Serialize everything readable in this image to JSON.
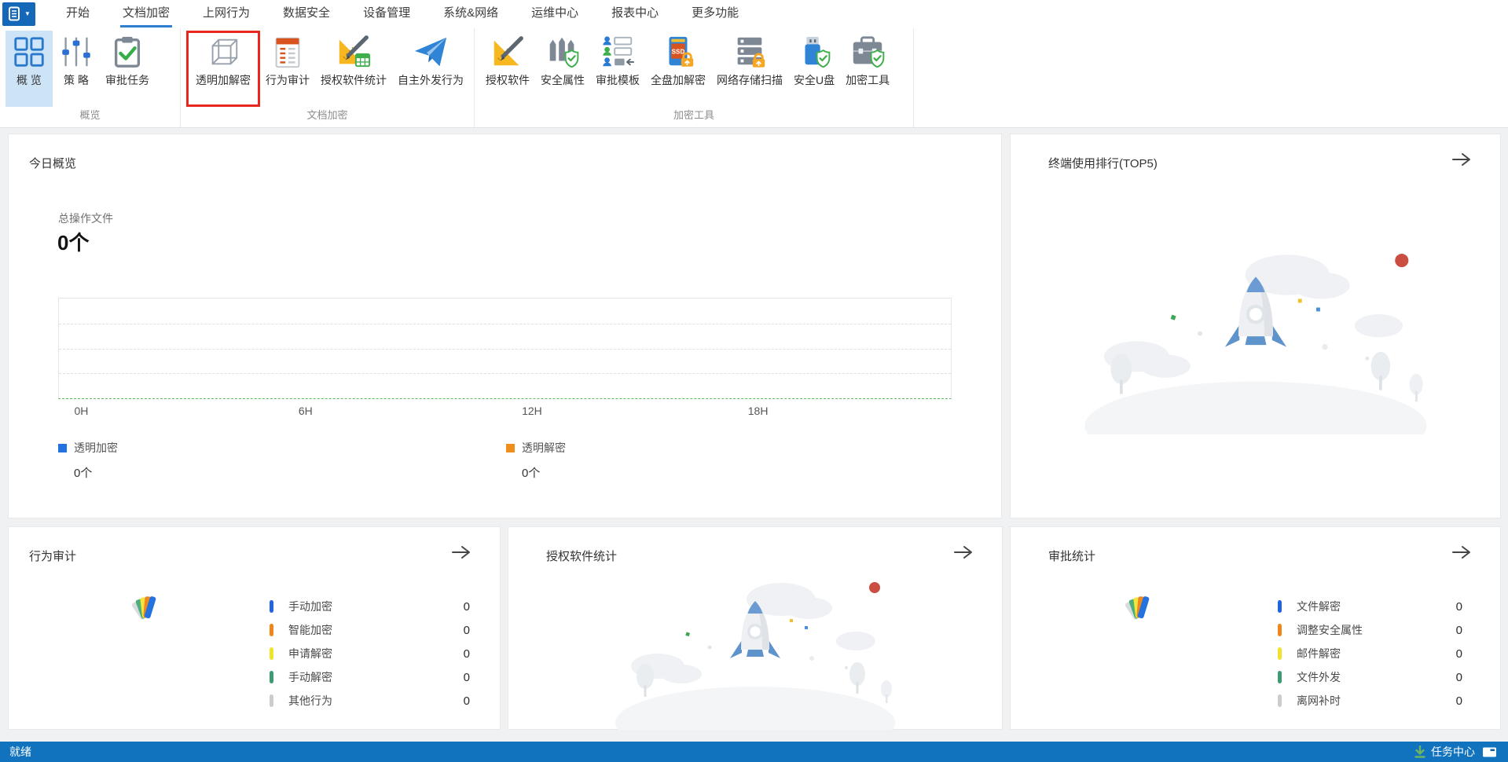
{
  "menubar": {
    "active_tab": "文档加密",
    "tabs": [
      {
        "label": "开始"
      },
      {
        "label": "文档加密"
      },
      {
        "label": "上网行为"
      },
      {
        "label": "数据安全"
      },
      {
        "label": "设备管理"
      },
      {
        "label": "系统&网络"
      },
      {
        "label": "运维中心"
      },
      {
        "label": "报表中心"
      },
      {
        "label": "更多功能"
      }
    ]
  },
  "ribbon": {
    "ssd_icon_text": "SSD",
    "highlight_color": "#e8281e",
    "selected_bg": "#cde4f7",
    "groups": [
      {
        "label": "概览",
        "items": [
          {
            "label": "概 览",
            "icon": "grid-overview-icon",
            "selected": true
          },
          {
            "label": "策 略",
            "icon": "sliders-policy-icon"
          },
          {
            "label": "审批任务",
            "icon": "clipboard-check-icon"
          }
        ]
      },
      {
        "label": "文档加密",
        "items": [
          {
            "label": "透明加解密",
            "icon": "wireframe-cube-icon",
            "highlighted": true
          },
          {
            "label": "行为审计",
            "icon": "audit-document-icon"
          },
          {
            "label": "授权软件统计",
            "icon": "ruler-pencil-table-icon"
          },
          {
            "label": "自主外发行为",
            "icon": "paper-plane-icon"
          }
        ]
      },
      {
        "label": "加密工具",
        "items": [
          {
            "label": "授权软件",
            "icon": "ruler-pencil-icon"
          },
          {
            "label": "安全属性",
            "icon": "fence-shield-icon"
          },
          {
            "label": "审批模板",
            "icon": "people-template-icon"
          },
          {
            "label": "全盘加解密",
            "icon": "ssd-lock-icon"
          },
          {
            "label": "网络存储扫描",
            "icon": "server-lock-icon"
          },
          {
            "label": "安全U盘",
            "icon": "usb-shield-icon"
          },
          {
            "label": "加密工具",
            "icon": "briefcase-shield-icon"
          }
        ]
      }
    ]
  },
  "cards": {
    "today": {
      "title": "今日概览",
      "total_label": "总操作文件",
      "total_value": "0个",
      "x_ticks": [
        "0H",
        "6H",
        "12H",
        "18H"
      ],
      "legend": [
        {
          "label": "透明加密",
          "value": "0个",
          "color": "#2272e0"
        },
        {
          "label": "透明解密",
          "value": "0个",
          "color": "#ef8d1d"
        }
      ]
    },
    "top5": {
      "title": "终端使用排行(TOP5)"
    },
    "behavior": {
      "title": "行为审计",
      "rows": [
        {
          "label": "手动加密",
          "value": "0",
          "color": "#2064e0"
        },
        {
          "label": "智能加密",
          "value": "0",
          "color": "#f08519"
        },
        {
          "label": "申请解密",
          "value": "0",
          "color": "#f0e32f"
        },
        {
          "label": "手动解密",
          "value": "0",
          "color": "#3d9b72"
        },
        {
          "label": "其他行为",
          "value": "0",
          "color": "#cccccc"
        }
      ]
    },
    "software": {
      "title": "授权软件统计"
    },
    "approval": {
      "title": "审批统计",
      "rows": [
        {
          "label": "文件解密",
          "value": "0",
          "color": "#2064e0"
        },
        {
          "label": "调整安全属性",
          "value": "0",
          "color": "#f08519"
        },
        {
          "label": "邮件解密",
          "value": "0",
          "color": "#f0e32f"
        },
        {
          "label": "文件外发",
          "value": "0",
          "color": "#3d9b72"
        },
        {
          "label": "离网补时",
          "value": "0",
          "color": "#cccccc"
        }
      ]
    }
  },
  "statusbar": {
    "ready": "就绪",
    "task_center": "任务中心",
    "bar_color": "#1173bd"
  }
}
